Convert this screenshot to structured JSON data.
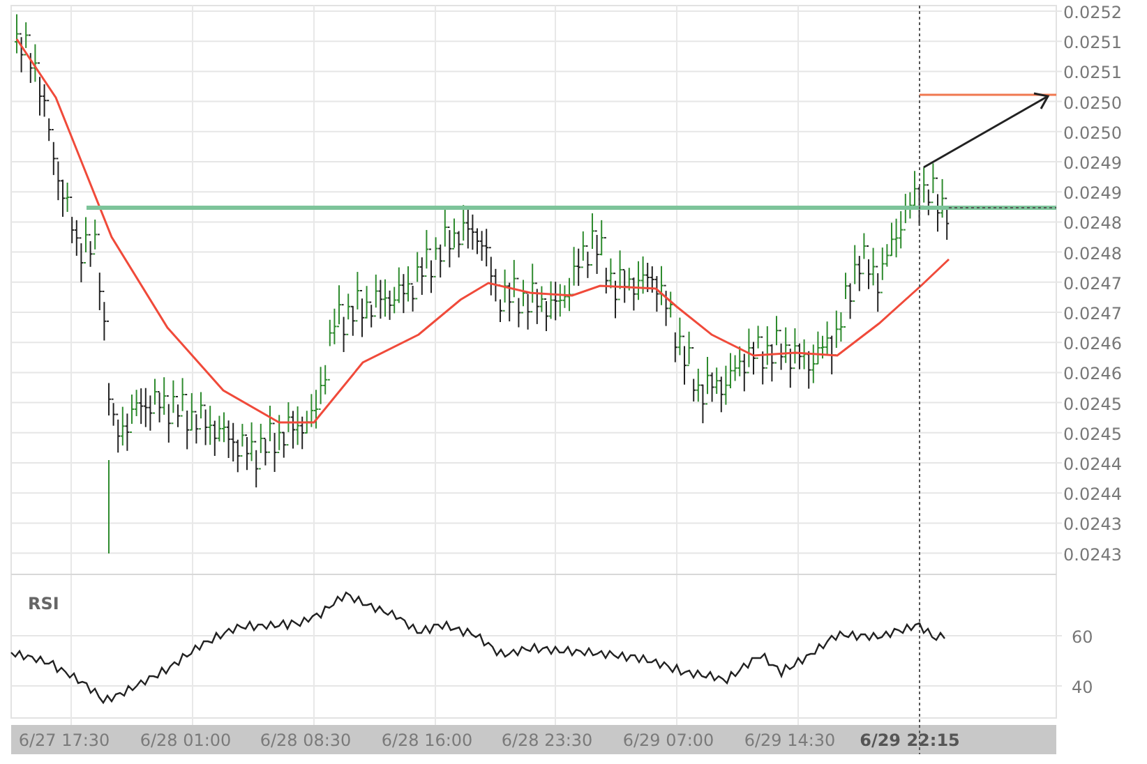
{
  "price_chart": {
    "y_axis_labels": [
      "0.0252",
      "0.0251",
      "0.0251",
      "0.0250",
      "0.0250",
      "0.0249",
      "0.0249",
      "0.0248",
      "0.0248",
      "0.0247",
      "0.0247",
      "0.0246",
      "0.0246",
      "0.0245",
      "0.0245",
      "0.0244",
      "0.0244",
      "0.0243",
      "0.0243"
    ]
  },
  "rsi_panel": {
    "title": "RSI",
    "y_axis_labels": [
      "60",
      "40"
    ]
  },
  "time_axis": [
    {
      "label": "6/27 17:30",
      "emphasized": false
    },
    {
      "label": "6/28 01:00",
      "emphasized": false
    },
    {
      "label": "6/28 08:30",
      "emphasized": false
    },
    {
      "label": "6/28 16:00",
      "emphasized": false
    },
    {
      "label": "6/28 23:30",
      "emphasized": false
    },
    {
      "label": "6/29 07:00",
      "emphasized": false
    },
    {
      "label": "6/29 14:30",
      "emphasized": false
    },
    {
      "label": "6/29 22:15",
      "emphasized": true
    }
  ]
}
